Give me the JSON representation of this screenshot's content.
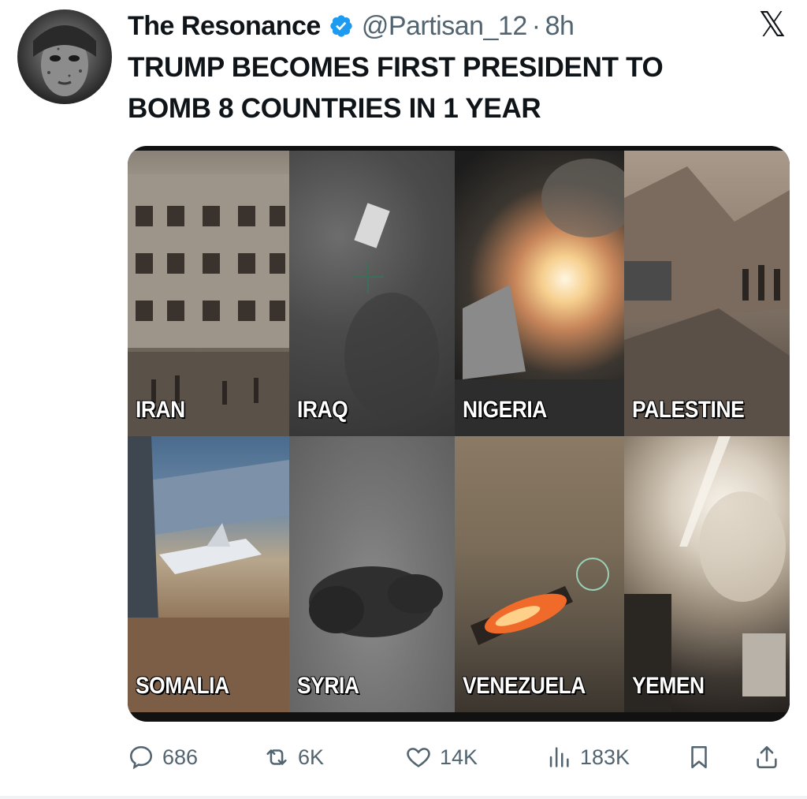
{
  "tweet": {
    "display_name": "The Resonance",
    "handle": "@Partisan_12",
    "separator": "·",
    "time": "8h",
    "text_line1": "TRUMP BECOMES FIRST PRESIDENT TO",
    "text_line2": "BOMB 8 COUNTRIES IN 1 YEAR",
    "verified": true,
    "verified_color": "#1d9bf0"
  },
  "brand": {
    "logo_icon": "x-logo-icon",
    "logo_text": "𝕏"
  },
  "media": {
    "panels": [
      {
        "label": "IRAN"
      },
      {
        "label": "IRAQ"
      },
      {
        "label": "NIGERIA"
      },
      {
        "label": "PALESTINE"
      },
      {
        "label": "SOMALIA"
      },
      {
        "label": "SYRIA"
      },
      {
        "label": "VENEZUELA"
      },
      {
        "label": "YEMEN"
      }
    ]
  },
  "actions": {
    "replies": "686",
    "reposts": "6K",
    "likes": "14K",
    "views": "183K"
  },
  "colors": {
    "text": "#0f1419",
    "secondary": "#536471"
  }
}
